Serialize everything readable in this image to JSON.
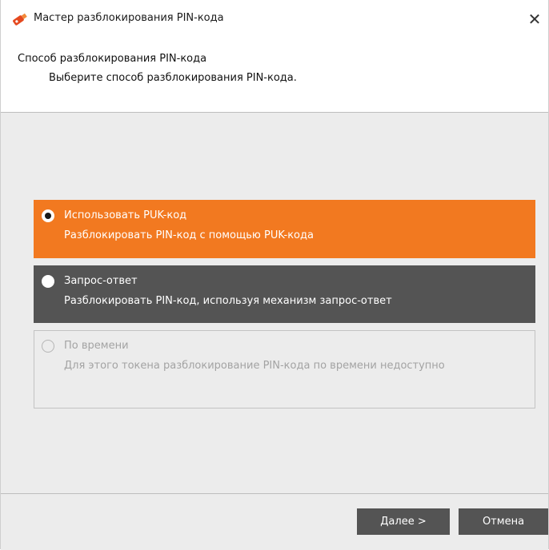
{
  "window": {
    "title": "Мастер разблокирования PIN-кода",
    "close_glyph": "✕"
  },
  "header": {
    "title": "Способ разблокирования PIN-кода",
    "subtitle": "Выберите способ разблокирования PIN-кода."
  },
  "options": [
    {
      "title": "Использовать PUK-код",
      "description": "Разблокировать PIN-код с помощью PUK-кода",
      "selected": true,
      "enabled": true,
      "background": "#f27920"
    },
    {
      "title": "Запрос-ответ",
      "description": "Разблокировать PIN-код, используя механизм запрос-ответ",
      "selected": false,
      "enabled": true,
      "background": "#545454"
    },
    {
      "title": "По времени",
      "description": "Для этого токена разблокирование PIN-кода по времени недоступно",
      "selected": false,
      "enabled": false,
      "background": "#ececec"
    }
  ],
  "buttons": {
    "next_label": "Далее >",
    "cancel_label": "Отмена"
  },
  "colors": {
    "accent": "#f27920",
    "dark": "#545454",
    "body_bg": "#ececec"
  },
  "icons": {
    "app": "usb-token-icon",
    "close": "close-icon"
  }
}
